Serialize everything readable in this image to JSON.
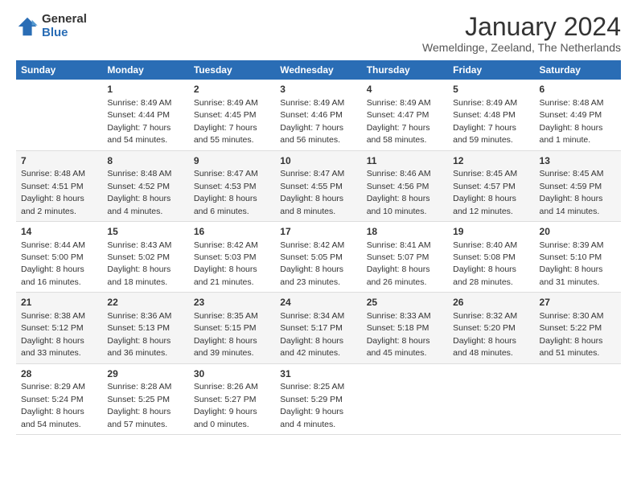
{
  "logo": {
    "line1": "General",
    "line2": "Blue"
  },
  "title": "January 2024",
  "subtitle": "Wemeldinge, Zeeland, The Netherlands",
  "days": [
    "Sunday",
    "Monday",
    "Tuesday",
    "Wednesday",
    "Thursday",
    "Friday",
    "Saturday"
  ],
  "weeks": [
    [
      {
        "num": "",
        "sunrise": "",
        "sunset": "",
        "daylight": ""
      },
      {
        "num": "1",
        "sunrise": "Sunrise: 8:49 AM",
        "sunset": "Sunset: 4:44 PM",
        "daylight": "Daylight: 7 hours and 54 minutes."
      },
      {
        "num": "2",
        "sunrise": "Sunrise: 8:49 AM",
        "sunset": "Sunset: 4:45 PM",
        "daylight": "Daylight: 7 hours and 55 minutes."
      },
      {
        "num": "3",
        "sunrise": "Sunrise: 8:49 AM",
        "sunset": "Sunset: 4:46 PM",
        "daylight": "Daylight: 7 hours and 56 minutes."
      },
      {
        "num": "4",
        "sunrise": "Sunrise: 8:49 AM",
        "sunset": "Sunset: 4:47 PM",
        "daylight": "Daylight: 7 hours and 58 minutes."
      },
      {
        "num": "5",
        "sunrise": "Sunrise: 8:49 AM",
        "sunset": "Sunset: 4:48 PM",
        "daylight": "Daylight: 7 hours and 59 minutes."
      },
      {
        "num": "6",
        "sunrise": "Sunrise: 8:48 AM",
        "sunset": "Sunset: 4:49 PM",
        "daylight": "Daylight: 8 hours and 1 minute."
      }
    ],
    [
      {
        "num": "7",
        "sunrise": "Sunrise: 8:48 AM",
        "sunset": "Sunset: 4:51 PM",
        "daylight": "Daylight: 8 hours and 2 minutes."
      },
      {
        "num": "8",
        "sunrise": "Sunrise: 8:48 AM",
        "sunset": "Sunset: 4:52 PM",
        "daylight": "Daylight: 8 hours and 4 minutes."
      },
      {
        "num": "9",
        "sunrise": "Sunrise: 8:47 AM",
        "sunset": "Sunset: 4:53 PM",
        "daylight": "Daylight: 8 hours and 6 minutes."
      },
      {
        "num": "10",
        "sunrise": "Sunrise: 8:47 AM",
        "sunset": "Sunset: 4:55 PM",
        "daylight": "Daylight: 8 hours and 8 minutes."
      },
      {
        "num": "11",
        "sunrise": "Sunrise: 8:46 AM",
        "sunset": "Sunset: 4:56 PM",
        "daylight": "Daylight: 8 hours and 10 minutes."
      },
      {
        "num": "12",
        "sunrise": "Sunrise: 8:45 AM",
        "sunset": "Sunset: 4:57 PM",
        "daylight": "Daylight: 8 hours and 12 minutes."
      },
      {
        "num": "13",
        "sunrise": "Sunrise: 8:45 AM",
        "sunset": "Sunset: 4:59 PM",
        "daylight": "Daylight: 8 hours and 14 minutes."
      }
    ],
    [
      {
        "num": "14",
        "sunrise": "Sunrise: 8:44 AM",
        "sunset": "Sunset: 5:00 PM",
        "daylight": "Daylight: 8 hours and 16 minutes."
      },
      {
        "num": "15",
        "sunrise": "Sunrise: 8:43 AM",
        "sunset": "Sunset: 5:02 PM",
        "daylight": "Daylight: 8 hours and 18 minutes."
      },
      {
        "num": "16",
        "sunrise": "Sunrise: 8:42 AM",
        "sunset": "Sunset: 5:03 PM",
        "daylight": "Daylight: 8 hours and 21 minutes."
      },
      {
        "num": "17",
        "sunrise": "Sunrise: 8:42 AM",
        "sunset": "Sunset: 5:05 PM",
        "daylight": "Daylight: 8 hours and 23 minutes."
      },
      {
        "num": "18",
        "sunrise": "Sunrise: 8:41 AM",
        "sunset": "Sunset: 5:07 PM",
        "daylight": "Daylight: 8 hours and 26 minutes."
      },
      {
        "num": "19",
        "sunrise": "Sunrise: 8:40 AM",
        "sunset": "Sunset: 5:08 PM",
        "daylight": "Daylight: 8 hours and 28 minutes."
      },
      {
        "num": "20",
        "sunrise": "Sunrise: 8:39 AM",
        "sunset": "Sunset: 5:10 PM",
        "daylight": "Daylight: 8 hours and 31 minutes."
      }
    ],
    [
      {
        "num": "21",
        "sunrise": "Sunrise: 8:38 AM",
        "sunset": "Sunset: 5:12 PM",
        "daylight": "Daylight: 8 hours and 33 minutes."
      },
      {
        "num": "22",
        "sunrise": "Sunrise: 8:36 AM",
        "sunset": "Sunset: 5:13 PM",
        "daylight": "Daylight: 8 hours and 36 minutes."
      },
      {
        "num": "23",
        "sunrise": "Sunrise: 8:35 AM",
        "sunset": "Sunset: 5:15 PM",
        "daylight": "Daylight: 8 hours and 39 minutes."
      },
      {
        "num": "24",
        "sunrise": "Sunrise: 8:34 AM",
        "sunset": "Sunset: 5:17 PM",
        "daylight": "Daylight: 8 hours and 42 minutes."
      },
      {
        "num": "25",
        "sunrise": "Sunrise: 8:33 AM",
        "sunset": "Sunset: 5:18 PM",
        "daylight": "Daylight: 8 hours and 45 minutes."
      },
      {
        "num": "26",
        "sunrise": "Sunrise: 8:32 AM",
        "sunset": "Sunset: 5:20 PM",
        "daylight": "Daylight: 8 hours and 48 minutes."
      },
      {
        "num": "27",
        "sunrise": "Sunrise: 8:30 AM",
        "sunset": "Sunset: 5:22 PM",
        "daylight": "Daylight: 8 hours and 51 minutes."
      }
    ],
    [
      {
        "num": "28",
        "sunrise": "Sunrise: 8:29 AM",
        "sunset": "Sunset: 5:24 PM",
        "daylight": "Daylight: 8 hours and 54 minutes."
      },
      {
        "num": "29",
        "sunrise": "Sunrise: 8:28 AM",
        "sunset": "Sunset: 5:25 PM",
        "daylight": "Daylight: 8 hours and 57 minutes."
      },
      {
        "num": "30",
        "sunrise": "Sunrise: 8:26 AM",
        "sunset": "Sunset: 5:27 PM",
        "daylight": "Daylight: 9 hours and 0 minutes."
      },
      {
        "num": "31",
        "sunrise": "Sunrise: 8:25 AM",
        "sunset": "Sunset: 5:29 PM",
        "daylight": "Daylight: 9 hours and 4 minutes."
      },
      {
        "num": "",
        "sunrise": "",
        "sunset": "",
        "daylight": ""
      },
      {
        "num": "",
        "sunrise": "",
        "sunset": "",
        "daylight": ""
      },
      {
        "num": "",
        "sunrise": "",
        "sunset": "",
        "daylight": ""
      }
    ]
  ]
}
